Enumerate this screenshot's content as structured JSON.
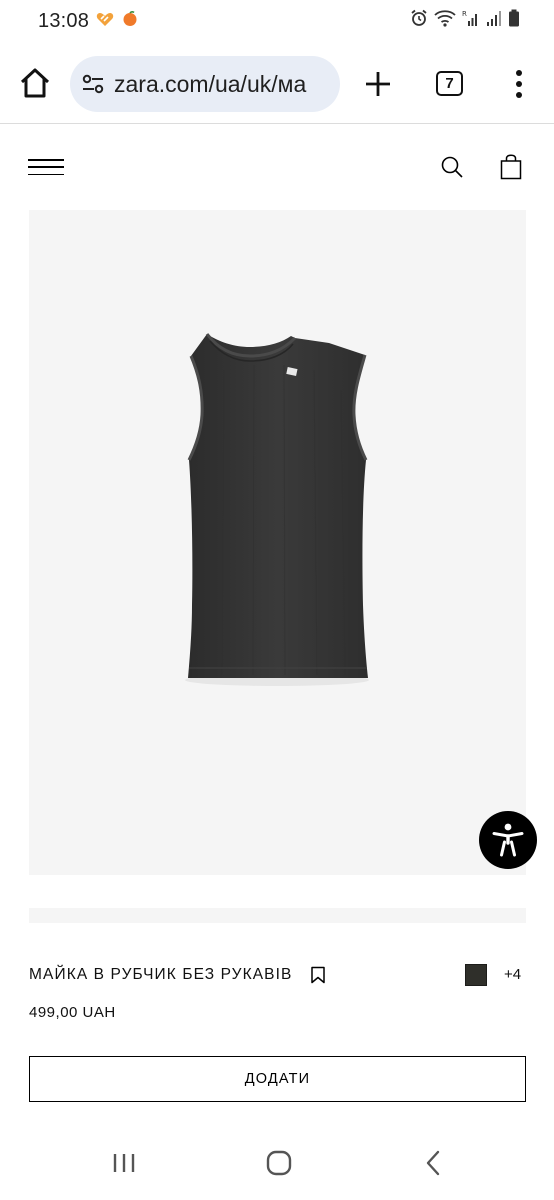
{
  "status_bar": {
    "time": "13:08",
    "icons": [
      "heart-badge-icon",
      "notification-dot-icon",
      "alarm-icon",
      "wifi-icon",
      "signal-icon",
      "signal-icon",
      "battery-icon"
    ]
  },
  "browser": {
    "url": "zara.com/ua/uk/ма",
    "tab_count": "7",
    "icons": [
      "home-icon",
      "site-settings-icon",
      "plus-icon",
      "tab-switcher-icon",
      "more-vert-icon"
    ]
  },
  "site_header": {
    "icons": [
      "hamburger-icon",
      "search-icon",
      "shopping-bag-icon"
    ]
  },
  "product": {
    "name": "МАЙКА В РУБЧИК БЕЗ РУКАВІВ",
    "price": "499,00 UAH",
    "more_colors": "+4",
    "swatch_color": "#2f2f2a",
    "add_button_label": "ДОДАТИ",
    "image_background": "#f5f5f5",
    "garment_color": "#353535"
  },
  "accessibility_button": {
    "icon": "accessibility-icon"
  },
  "android_nav": {
    "icons": [
      "recent-apps-icon",
      "home-circle-icon",
      "back-chevron-icon"
    ]
  }
}
